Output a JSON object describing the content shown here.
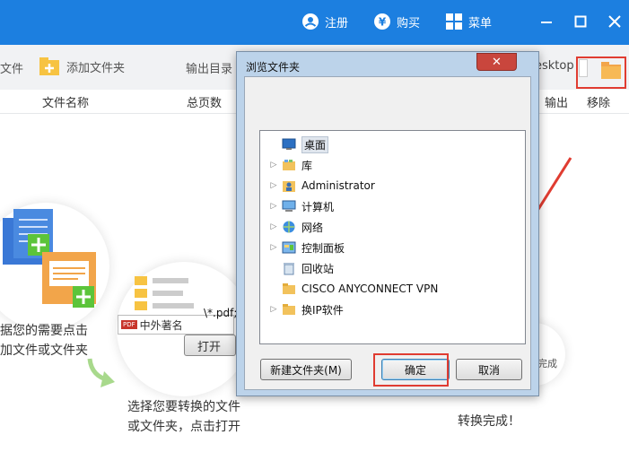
{
  "titlebar": {
    "register_label": "注册",
    "buy_label": "购买",
    "menu_label": "菜单"
  },
  "toolbar": {
    "add_file_label": "文件",
    "add_folder_label": "添加文件夹",
    "output_dir_label": "输出目录",
    "output_path": "esktop"
  },
  "columns": {
    "name": "文件名称",
    "pages": "总页数",
    "output": "输出",
    "remove": "移除"
  },
  "illustration": {
    "step1_text_line1": "据您的需要点击",
    "step1_text_line2": "加文件或文件夹",
    "step2_text_line1": "选择您要转换的文件",
    "step2_text_line2": "或文件夹，点击打开",
    "step2_file_name": "中外著名",
    "step2_filter": "\\*.pdf;*.",
    "step2_open_label": "打开",
    "step3_text": "转换完成！",
    "step3_badge": "完成"
  },
  "dialog": {
    "title": "浏览文件夹",
    "tree": [
      {
        "label": "桌面",
        "icon": "desktop-icon",
        "expandable": false,
        "selected": true,
        "level": 0
      },
      {
        "label": "库",
        "icon": "library-icon",
        "expandable": true,
        "selected": false,
        "level": 1
      },
      {
        "label": "Administrator",
        "icon": "user-folder-icon",
        "expandable": true,
        "selected": false,
        "level": 1
      },
      {
        "label": "计算机",
        "icon": "computer-icon",
        "expandable": true,
        "selected": false,
        "level": 1
      },
      {
        "label": "网络",
        "icon": "network-icon",
        "expandable": true,
        "selected": false,
        "level": 1
      },
      {
        "label": "控制面板",
        "icon": "control-panel-icon",
        "expandable": true,
        "selected": false,
        "level": 1
      },
      {
        "label": "回收站",
        "icon": "recycle-bin-icon",
        "expandable": false,
        "selected": false,
        "level": 1
      },
      {
        "label": "CISCO ANYCONNECT VPN",
        "icon": "folder-icon",
        "expandable": false,
        "selected": false,
        "level": 1
      },
      {
        "label": "换IP软件",
        "icon": "folder-icon",
        "expandable": true,
        "selected": false,
        "level": 1
      }
    ],
    "new_folder_label": "新建文件夹(M)",
    "ok_label": "确定",
    "cancel_label": "取消"
  },
  "colors": {
    "titlebar": "#1c7fe0",
    "highlight": "#e03c31",
    "accent_green": "#5cc43a",
    "accent_orange": "#f2a54a"
  }
}
